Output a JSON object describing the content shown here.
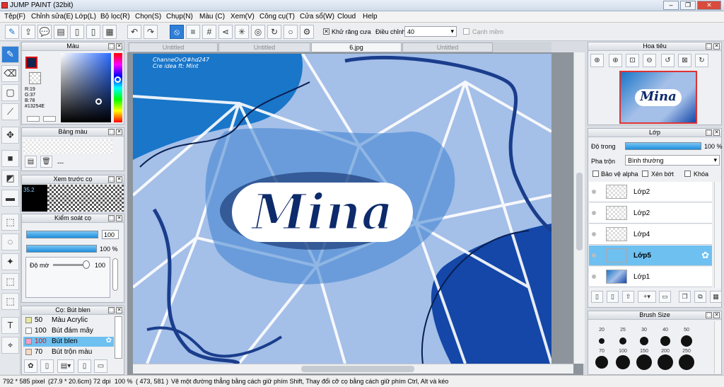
{
  "app": {
    "title": "JUMP PAINT (32bit)"
  },
  "menu": [
    "Tệp(F)",
    "Chỉnh sửa(E)",
    "Lớp(L)",
    "Bộ lọc(R)",
    "Chọn(S)",
    "Chụp(N)",
    "Màu (C)",
    "Xem(V)",
    "Công cụ(T)",
    "Cửa sổ(W)",
    "Cloud",
    "Help"
  ],
  "toolbar": {
    "antialias_label": "Khử răng cưa",
    "adjust_label": "Điều chỉnh",
    "adjust_value": "40",
    "edge_label": "Cạnh mềm"
  },
  "color_panel": {
    "title": "Màu",
    "r": "R:19",
    "g": "G:37",
    "b": "B:78",
    "hex": "#13254E",
    "fg_color": "#13254E"
  },
  "palette_panel": {
    "title": "Bảng màu",
    "dashes": "---"
  },
  "preview_panel": {
    "title": "Xem trước cọ",
    "value": "35.2"
  },
  "brush_control": {
    "title": "Kiểm soát cọ",
    "size_value": "100",
    "opacity_value": "100 %",
    "blur_label": "Độ mờ",
    "blur_value": "100"
  },
  "brush_list": {
    "title": "Cọ: Bút blen",
    "items": [
      {
        "size": "50",
        "name": "Màu Acrylic",
        "color": "#e8e8a0",
        "selected": false
      },
      {
        "size": "100",
        "name": "Bút đám mây",
        "color": "#ffffff",
        "selected": false
      },
      {
        "size": "100",
        "name": "Bút blen",
        "color": "#f2a0c8",
        "selected": true
      },
      {
        "size": "70",
        "name": "Bút trộn màu",
        "color": "#f5d9c5",
        "selected": false
      }
    ]
  },
  "tabs": [
    "Untitled",
    "Untitled",
    "6.jpg",
    "Untitled"
  ],
  "artwork": {
    "credit1": "ChanneOvO#hd247",
    "credit2": "Cre idea ft: Mint",
    "title_text": "Mina"
  },
  "navigator": {
    "title": "Hoa tiêu",
    "thumb_text": "Mina"
  },
  "layer_panel": {
    "title": "Lớp",
    "opacity_label": "Độ trong",
    "opacity_value": "100 %",
    "blend_label": "Pha trộn",
    "blend_value": "Bình thường",
    "protect_alpha": "Bảo vệ alpha",
    "clip": "Xén bớt",
    "lock": "Khóa",
    "layers": [
      {
        "name": "Lớp2",
        "selected": false
      },
      {
        "name": "Lớp2",
        "selected": false
      },
      {
        "name": "Lớp4",
        "selected": false
      },
      {
        "name": "Lớp5",
        "selected": true
      },
      {
        "name": "Lớp1",
        "selected": false
      }
    ]
  },
  "brush_size_panel": {
    "title": "Brush Size",
    "sizes": [
      "20",
      "25",
      "30",
      "40",
      "50",
      "70",
      "100",
      "150",
      "200",
      "250"
    ]
  },
  "status": {
    "size": "792 * 585 pixel",
    "cm": "(27.9 * 20.6cm)",
    "dpi": "72 dpi",
    "zoom": "100 %",
    "coords": "( 473, 581 )",
    "hint": "Vẽ một đường thẳng bằng cách giữ phím Shift, Thay đổi cỡ cọ bằng cách giữ phím Ctrl, Alt và kéo"
  }
}
